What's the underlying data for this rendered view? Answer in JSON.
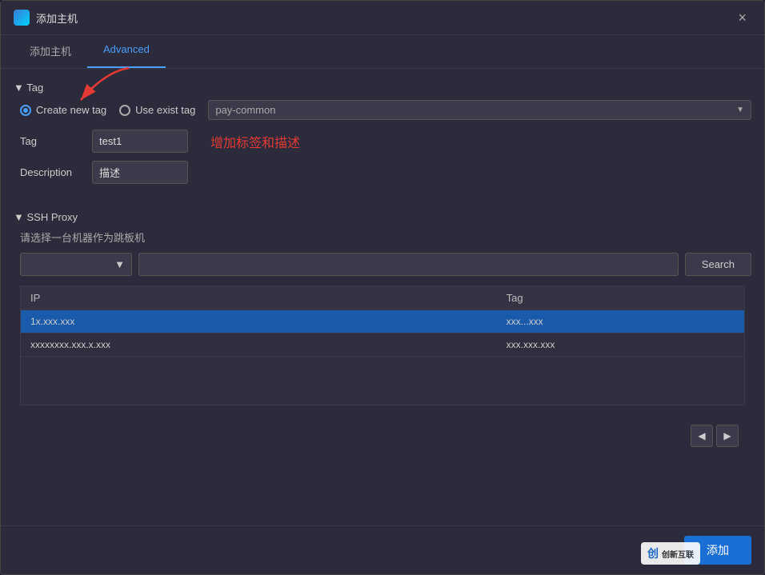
{
  "dialog": {
    "title": "添加主机",
    "close_label": "×"
  },
  "tabs": [
    {
      "id": "add-host",
      "label": "添加主机",
      "active": false
    },
    {
      "id": "advanced",
      "label": "Advanced",
      "active": true
    }
  ],
  "tag_section": {
    "header": "▼ Tag",
    "radio_create": "Create new tag",
    "radio_use": "Use exist tag",
    "dropdown_value": "pay-common",
    "tag_label": "Tag",
    "tag_value": "test1",
    "description_label": "Description",
    "description_value": "描述",
    "annotation": "增加标签和描述"
  },
  "ssh_proxy": {
    "header": "▼ SSH Proxy",
    "hint": "请选择一台机器作为跳板机",
    "search_label": "Search",
    "table": {
      "columns": [
        "IP",
        "Tag"
      ],
      "rows": [
        {
          "ip": "1x.xxx.xxx",
          "tag": "xxx...xxx",
          "selected": true
        },
        {
          "ip": "xxxxxxxx.xxx.x.xxx",
          "tag": "xxx.xxx.xxx",
          "selected": false
        }
      ]
    }
  },
  "pagination": {
    "prev_label": "◀",
    "next_label": "▶"
  },
  "footer": {
    "add_label": "添加"
  },
  "watermark": {
    "text": "创新互联"
  }
}
